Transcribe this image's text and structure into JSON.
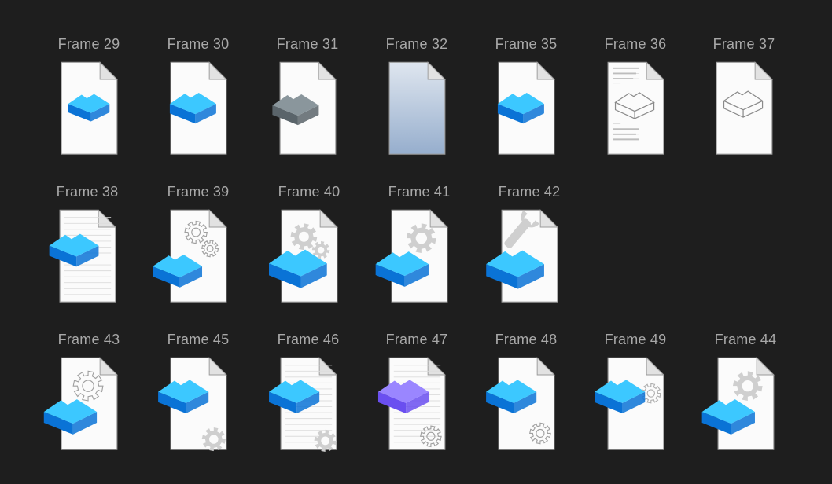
{
  "canvas": {
    "background": "#1e1e1e"
  },
  "colors": {
    "page_fill": "#fbfbfb",
    "page_stroke": "#9a9a9a",
    "fold_fill": "#e2e2e2",
    "gear_gray": "#cfcfcf",
    "outline_gray": "#8a8a8a",
    "blue_top": "#3cc8ff",
    "blue_mid": "#1aa6f2",
    "blue_side": "#0a73d6",
    "gray_top": "#8a969c",
    "gray_side": "#5a646a",
    "purple_top": "#9a86ff",
    "purple_side": "#6a4ff0"
  },
  "rows": [
    {
      "frames": [
        {
          "label": "Frame 29",
          "icon": "file-blue-stack-small-icon"
        },
        {
          "label": "Frame 30",
          "icon": "file-blue-stack-icon"
        },
        {
          "label": "Frame 31",
          "icon": "file-gray-stack-icon"
        },
        {
          "label": "Frame 32",
          "icon": "file-gradient-blank-icon"
        },
        {
          "label": "Frame 35",
          "icon": "file-blue-stack-icon"
        },
        {
          "label": "Frame 36",
          "icon": "file-outline-stack-lines-icon"
        },
        {
          "label": "Frame 37",
          "icon": "file-outline-stack-icon"
        }
      ]
    },
    {
      "frames": [
        {
          "label": "Frame 38",
          "icon": "file-lines-blue-stack-icon"
        },
        {
          "label": "Frame 39",
          "icon": "file-gears-outline-blue-stack-icon"
        },
        {
          "label": "Frame 40",
          "icon": "file-gears-blue-stack-icon"
        },
        {
          "label": "Frame 41",
          "icon": "file-gear-blue-stack-icon"
        },
        {
          "label": "Frame 42",
          "icon": "file-wrench-blue-stack-icon"
        }
      ]
    },
    {
      "frames": [
        {
          "label": "Frame 43",
          "icon": "file-gear-outline-blue-stack-icon"
        },
        {
          "label": "Frame 45",
          "icon": "file-blue-stack-corner-gear-icon"
        },
        {
          "label": "Frame 46",
          "icon": "file-lines-blue-stack-corner-gear-icon"
        },
        {
          "label": "Frame 47",
          "icon": "file-lines-purple-stack-gear-icon"
        },
        {
          "label": "Frame 48",
          "icon": "file-blue-stack-gear-outline-icon"
        },
        {
          "label": "Frame 49",
          "icon": "file-blue-stack-side-gear-icon"
        },
        {
          "label": "Frame 44",
          "icon": "file-gear-blue-stack-icon"
        }
      ]
    }
  ]
}
